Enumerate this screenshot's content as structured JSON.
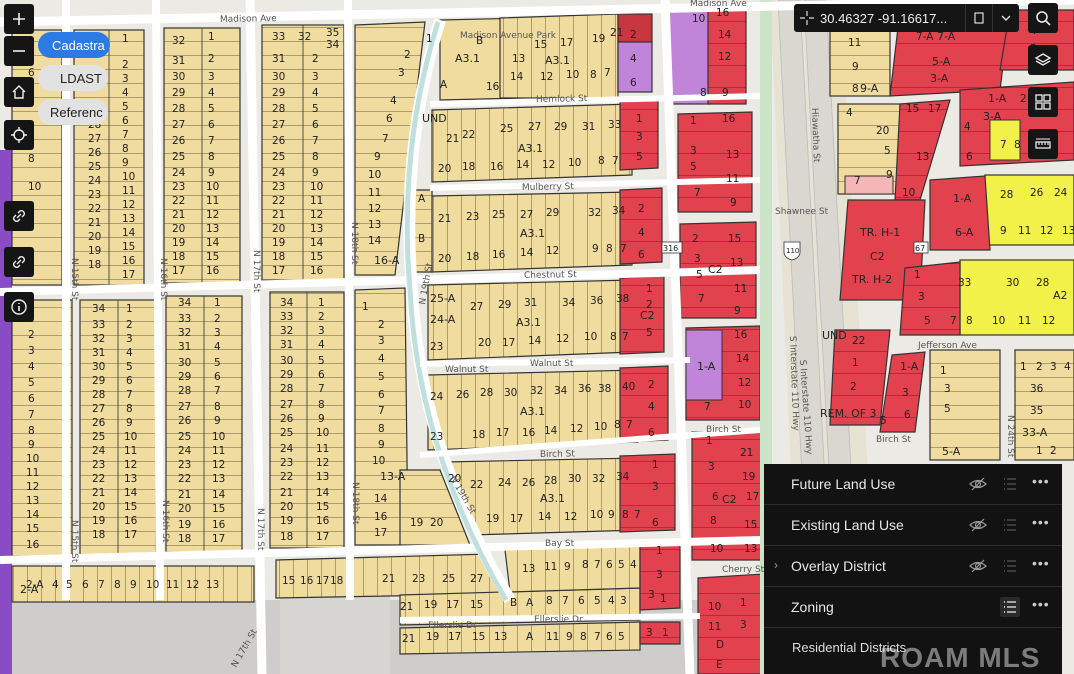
{
  "colors": {
    "residential": "#f1dc9f",
    "commercial": "#e1424d",
    "light_industry": "#c084d8",
    "heavy_zone": "#f2f14a",
    "und": "#f6eec8",
    "gray_area": "#cfcdcb",
    "street": "#ffffff",
    "water": "#c6e1e1",
    "highway": "#ebe7d8",
    "panel_bg": "#121212"
  },
  "layer_pills": [
    {
      "label": "Cadastra",
      "active": true
    },
    {
      "label": "LDAST",
      "active": false
    },
    {
      "label": "Referenc",
      "active": false
    }
  ],
  "left_toolbar": [
    "zoom-in-icon",
    "zoom-out-icon",
    "home-icon",
    "locate-icon",
    "link-icon",
    "link-alt-icon",
    "info-icon"
  ],
  "coordinates": "30.46327 -91.16617...",
  "right_toolbar": [
    "search-icon",
    "layers-icon",
    "basemap-gallery-icon",
    "measure-icon"
  ],
  "streets": {
    "madison_west": "Madison Ave",
    "madison_east": "Madison Ave",
    "hemlock": "Hemlock St",
    "mulberry": "Mulberry St",
    "chestnut": "Chestnut St",
    "walnut_a": "Walnut St",
    "walnut_b": "Walnut St",
    "birch": "Birch St",
    "birch_east": "Birch St",
    "bay": "Bay St",
    "ellerslie_a": "Ellerslie Dr",
    "ellerslie_b": "Ellerslie Dr",
    "shawnee": "Shawnee St",
    "hiawatha": "Hiawatha St",
    "jefferson": "Jefferson Ave",
    "cherry": "Cherry St",
    "n15_a": "N 15th St",
    "n15_b": "N 15th St",
    "n16_a": "N 16th St",
    "n16_b": "N 16th St",
    "n17_a": "N 17th St",
    "n17_b": "N 17th St",
    "n17_c": "N 17th St",
    "n18_a": "N 18th St",
    "n18_b": "N 18th St",
    "n19_a": "N 19th St",
    "n19_b": "N 19th St",
    "i110_a": "S Interstate 110 Hwy",
    "i110_b": "S Interstate 110 Hwy",
    "n24": "N 24th St",
    "park": "Madison Avenue Park"
  },
  "zones": {
    "a31_1": "A3.1",
    "a31_2": "A3.1",
    "a31_3": "A3.1",
    "a31_4": "A3.1",
    "a31_5": "A3.1",
    "a31_6": "A3.1",
    "a31_7": "A3.1",
    "a31_8": "A3.1",
    "und_1": "UND",
    "und_2": "UND",
    "c2_1": "C2",
    "c2_2": "C2",
    "c2_3": "C2",
    "c2_4": "C2",
    "trh1": "TR. H-1",
    "trh2": "TR. H-2",
    "rem": "REM. OF 3",
    "a2": "A2",
    "la1": "1-A",
    "la2": "1-A",
    "la3": "1-A",
    "la4": "1-A",
    "la5": "6-A",
    "la6": "7-A",
    "la7": "5-A",
    "la8": "3-A",
    "la9": "3-A",
    "la10": "16-A",
    "la11": "13-A",
    "la12": "25-A",
    "la13": "24-A",
    "la14": "2-A",
    "la15": "33-A",
    "la16": "5-A",
    "la17": "9-A"
  },
  "highway_shields": {
    "i110": "110",
    "us67": "67",
    "s316": "316"
  },
  "layer_panel": {
    "layers": [
      {
        "name": "Future Land Use",
        "expandable": false
      },
      {
        "name": "Existing Land Use",
        "expandable": false
      },
      {
        "name": "Overlay District",
        "expandable": true
      },
      {
        "name": "Zoning",
        "expandable": false
      }
    ],
    "sublabel": "Residential Districts"
  },
  "watermark": "ROAM MLS"
}
